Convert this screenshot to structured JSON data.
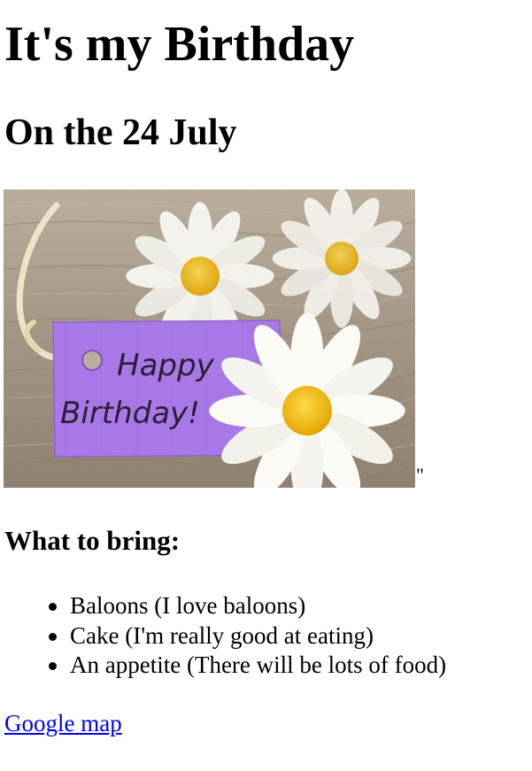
{
  "page": {
    "title": "It's my Birthday",
    "date_heading": "On the 24 July",
    "stray_quote": "\"",
    "section_heading": "What to bring:",
    "bring_list": [
      "Baloons (I love baloons)",
      "Cake (I'm really good at eating)",
      "An appetite (There will be lots of food)"
    ],
    "map_link": "Google map"
  },
  "image": {
    "tag_text_line1": "Happy",
    "tag_text_line2": "Birthday!"
  },
  "colors": {
    "link": "#0000ee",
    "tag_purple": "#a879e6",
    "daisy_center": "#f2be10",
    "wood": "#a39583"
  }
}
